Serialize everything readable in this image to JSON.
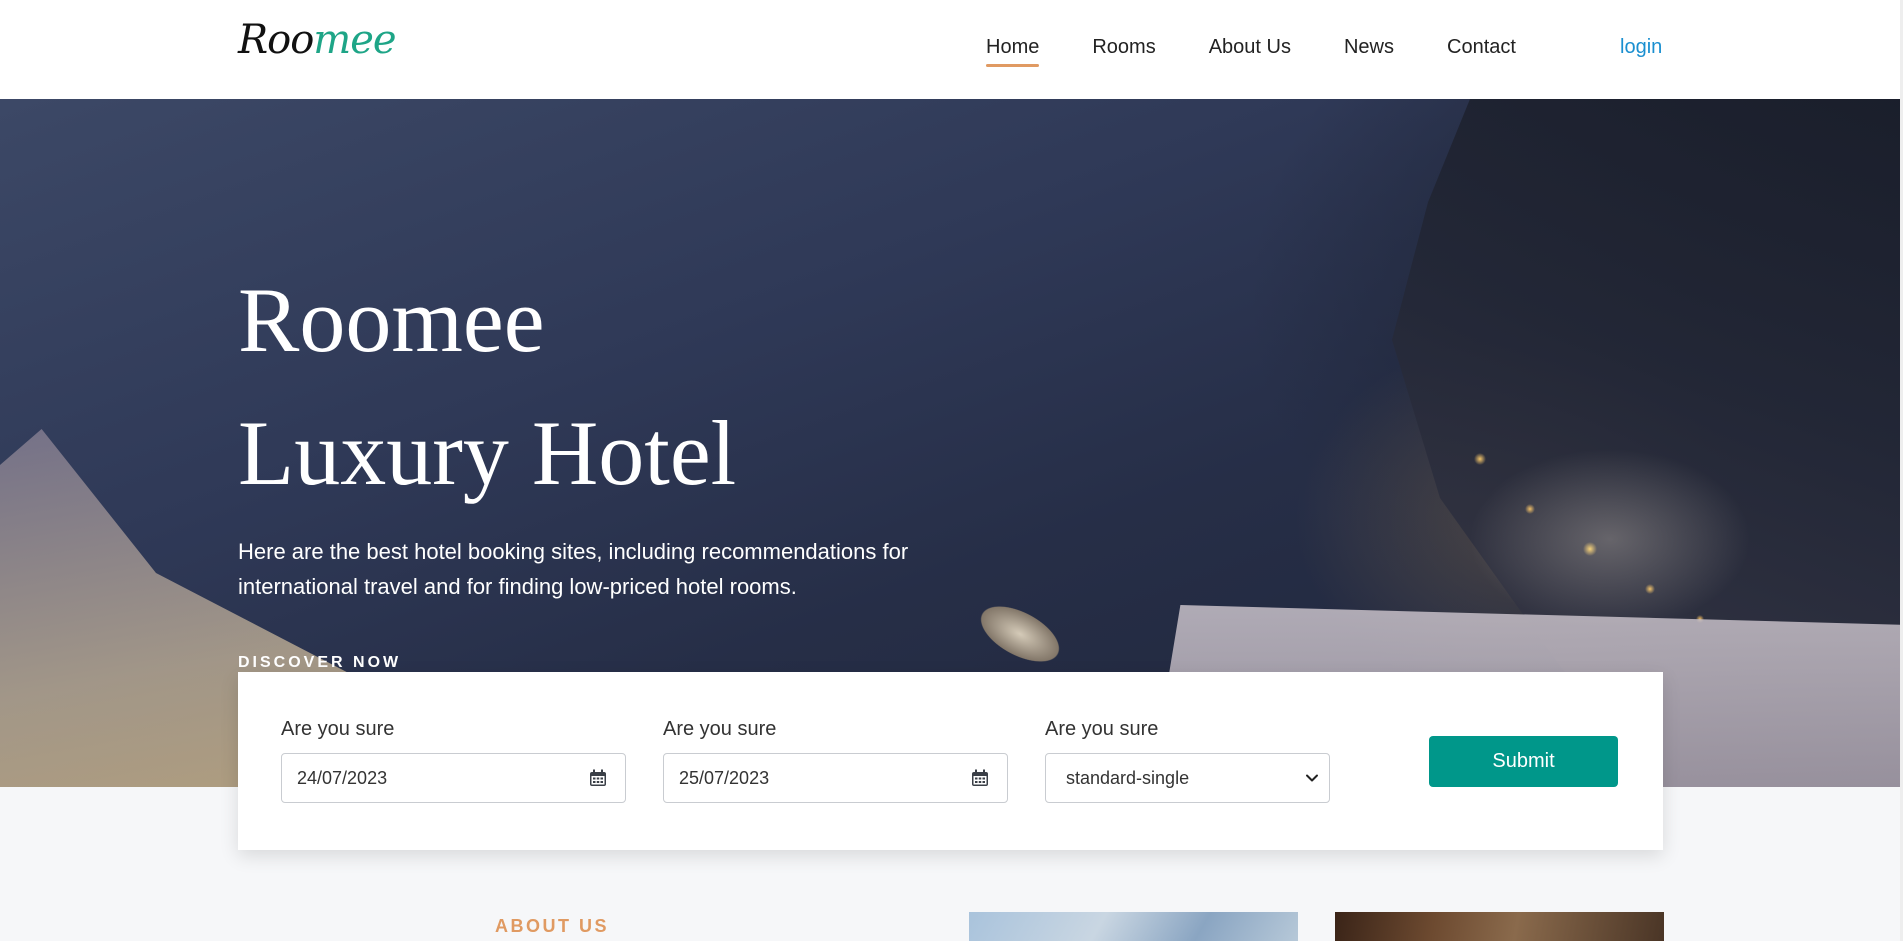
{
  "header": {
    "logo": {
      "part1": "Roo",
      "part2": "mee"
    },
    "nav": [
      {
        "label": "Home",
        "active": true
      },
      {
        "label": "Rooms",
        "active": false
      },
      {
        "label": "About Us",
        "active": false
      },
      {
        "label": "News",
        "active": false
      },
      {
        "label": "Contact",
        "active": false
      }
    ],
    "login_label": "login"
  },
  "hero": {
    "title_line1": "Roomee",
    "title_line2": "Luxury Hotel",
    "description": "Here are the best hotel booking sites, including recommendations for international travel and for finding low-priced hotel rooms.",
    "cta_label": "DISCOVER NOW"
  },
  "booking": {
    "checkin": {
      "label": "Are you sure",
      "value": "24/07/2023",
      "icon": "calendar-icon"
    },
    "checkout": {
      "label": "Are you sure",
      "value": "25/07/2023",
      "icon": "calendar-icon"
    },
    "room_type": {
      "label": "Are you sure",
      "value": "standard-single",
      "icon": "chevron-down-icon"
    },
    "submit_label": "Submit"
  },
  "about": {
    "section_label": "ABOUT US"
  },
  "colors": {
    "accent": "#e09a62",
    "logo_green": "#1ea587",
    "primary_button": "#00978a",
    "login_link": "#1a8fd0"
  }
}
